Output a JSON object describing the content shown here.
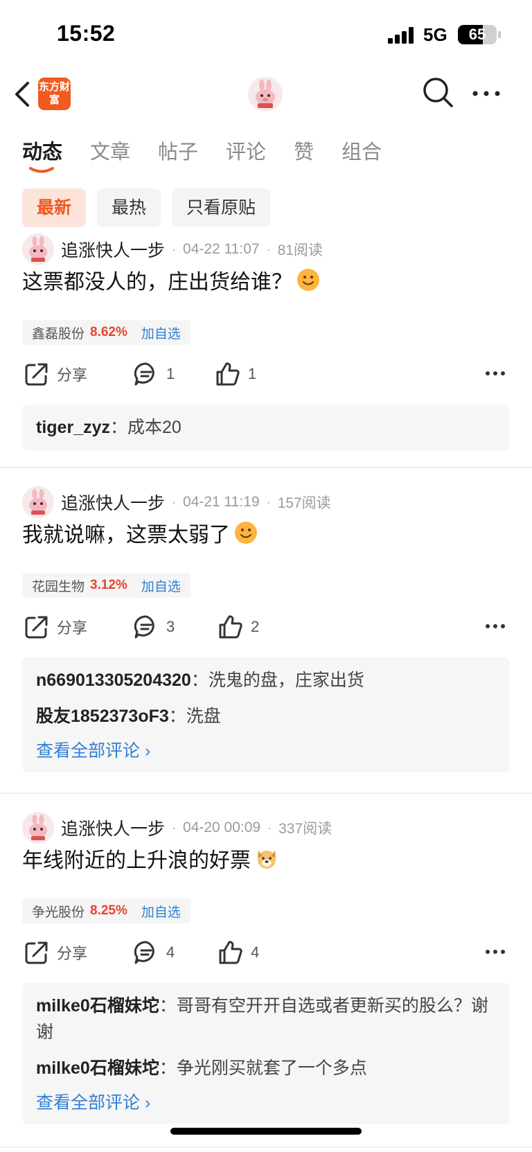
{
  "status": {
    "time": "15:52",
    "network": "5G",
    "battery": "65",
    "battery_level": 0.65
  },
  "header": {
    "logo_text": "东方财富"
  },
  "tabs": [
    {
      "label": "动态"
    },
    {
      "label": "文章"
    },
    {
      "label": "帖子"
    },
    {
      "label": "评论"
    },
    {
      "label": "赞"
    },
    {
      "label": "组合"
    }
  ],
  "filters": [
    {
      "label": "最新"
    },
    {
      "label": "最热"
    },
    {
      "label": "只看原贴"
    }
  ],
  "posts": [
    {
      "author": "追涨快人一步",
      "time": "04-22 11:07",
      "reads": "81阅读",
      "text": "这票都没人的，庄出货给谁？",
      "emoji": "smile",
      "stock": {
        "name": "鑫磊股份",
        "change": "8.62%",
        "add": "加自选"
      },
      "share": "分享",
      "comment_count": "1",
      "like_count": "1",
      "comments": [
        {
          "user": "tiger_zyz",
          "sep": "：",
          "text": "成本20"
        }
      ]
    },
    {
      "author": "追涨快人一步",
      "time": "04-21 11:19",
      "reads": "157阅读",
      "text": "我就说嘛，这票太弱了",
      "emoji": "smile",
      "stock": {
        "name": "花园生物",
        "change": "3.12%",
        "add": "加自选"
      },
      "share": "分享",
      "comment_count": "3",
      "like_count": "2",
      "comments": [
        {
          "user": "n669013305204320",
          "sep": "：",
          "text": "洗鬼的盘，庄家出货"
        },
        {
          "user": "股友1852373oF3",
          "sep": "：",
          "text": "洗盘"
        }
      ],
      "view_all": "查看全部评论 ›"
    },
    {
      "author": "追涨快人一步",
      "time": "04-20 00:09",
      "reads": "337阅读",
      "text": "年线附近的上升浪的好票",
      "emoji": "dog",
      "stock": {
        "name": "争光股份",
        "change": "8.25%",
        "add": "加自选"
      },
      "share": "分享",
      "comment_count": "4",
      "like_count": "4",
      "comments": [
        {
          "user": "milke0石榴妹坨",
          "sep": "：",
          "text": "哥哥有空开开自选或者更新买的股么？谢谢"
        },
        {
          "user": "milke0石榴妹坨",
          "sep": "：",
          "text": "争光刚买就套了一个多点"
        }
      ],
      "view_all": "查看全部评论 ›"
    }
  ],
  "meta_sep": "·",
  "icons": {
    "back": "back-chevron-icon",
    "search": "search-icon",
    "more": "more-dots-icon",
    "share": "share-icon",
    "comment": "comment-icon",
    "like": "thumbs-up-icon"
  },
  "colors": {
    "accent": "#f05a22",
    "rise": "#e8432d",
    "link": "#2f7fd4",
    "logo_bg": "#f25a1f"
  }
}
